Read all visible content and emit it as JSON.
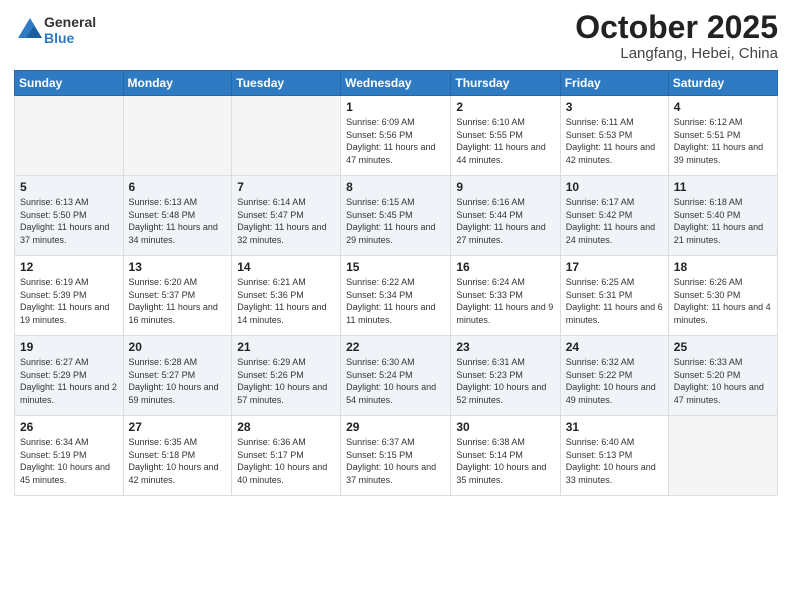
{
  "header": {
    "logo_line1": "General",
    "logo_line2": "Blue",
    "month": "October 2025",
    "location": "Langfang, Hebei, China"
  },
  "days_of_week": [
    "Sunday",
    "Monday",
    "Tuesday",
    "Wednesday",
    "Thursday",
    "Friday",
    "Saturday"
  ],
  "weeks": [
    [
      {
        "day": "",
        "info": ""
      },
      {
        "day": "",
        "info": ""
      },
      {
        "day": "",
        "info": ""
      },
      {
        "day": "1",
        "info": "Sunrise: 6:09 AM\nSunset: 5:56 PM\nDaylight: 11 hours and 47 minutes."
      },
      {
        "day": "2",
        "info": "Sunrise: 6:10 AM\nSunset: 5:55 PM\nDaylight: 11 hours and 44 minutes."
      },
      {
        "day": "3",
        "info": "Sunrise: 6:11 AM\nSunset: 5:53 PM\nDaylight: 11 hours and 42 minutes."
      },
      {
        "day": "4",
        "info": "Sunrise: 6:12 AM\nSunset: 5:51 PM\nDaylight: 11 hours and 39 minutes."
      }
    ],
    [
      {
        "day": "5",
        "info": "Sunrise: 6:13 AM\nSunset: 5:50 PM\nDaylight: 11 hours and 37 minutes."
      },
      {
        "day": "6",
        "info": "Sunrise: 6:13 AM\nSunset: 5:48 PM\nDaylight: 11 hours and 34 minutes."
      },
      {
        "day": "7",
        "info": "Sunrise: 6:14 AM\nSunset: 5:47 PM\nDaylight: 11 hours and 32 minutes."
      },
      {
        "day": "8",
        "info": "Sunrise: 6:15 AM\nSunset: 5:45 PM\nDaylight: 11 hours and 29 minutes."
      },
      {
        "day": "9",
        "info": "Sunrise: 6:16 AM\nSunset: 5:44 PM\nDaylight: 11 hours and 27 minutes."
      },
      {
        "day": "10",
        "info": "Sunrise: 6:17 AM\nSunset: 5:42 PM\nDaylight: 11 hours and 24 minutes."
      },
      {
        "day": "11",
        "info": "Sunrise: 6:18 AM\nSunset: 5:40 PM\nDaylight: 11 hours and 21 minutes."
      }
    ],
    [
      {
        "day": "12",
        "info": "Sunrise: 6:19 AM\nSunset: 5:39 PM\nDaylight: 11 hours and 19 minutes."
      },
      {
        "day": "13",
        "info": "Sunrise: 6:20 AM\nSunset: 5:37 PM\nDaylight: 11 hours and 16 minutes."
      },
      {
        "day": "14",
        "info": "Sunrise: 6:21 AM\nSunset: 5:36 PM\nDaylight: 11 hours and 14 minutes."
      },
      {
        "day": "15",
        "info": "Sunrise: 6:22 AM\nSunset: 5:34 PM\nDaylight: 11 hours and 11 minutes."
      },
      {
        "day": "16",
        "info": "Sunrise: 6:24 AM\nSunset: 5:33 PM\nDaylight: 11 hours and 9 minutes."
      },
      {
        "day": "17",
        "info": "Sunrise: 6:25 AM\nSunset: 5:31 PM\nDaylight: 11 hours and 6 minutes."
      },
      {
        "day": "18",
        "info": "Sunrise: 6:26 AM\nSunset: 5:30 PM\nDaylight: 11 hours and 4 minutes."
      }
    ],
    [
      {
        "day": "19",
        "info": "Sunrise: 6:27 AM\nSunset: 5:29 PM\nDaylight: 11 hours and 2 minutes."
      },
      {
        "day": "20",
        "info": "Sunrise: 6:28 AM\nSunset: 5:27 PM\nDaylight: 10 hours and 59 minutes."
      },
      {
        "day": "21",
        "info": "Sunrise: 6:29 AM\nSunset: 5:26 PM\nDaylight: 10 hours and 57 minutes."
      },
      {
        "day": "22",
        "info": "Sunrise: 6:30 AM\nSunset: 5:24 PM\nDaylight: 10 hours and 54 minutes."
      },
      {
        "day": "23",
        "info": "Sunrise: 6:31 AM\nSunset: 5:23 PM\nDaylight: 10 hours and 52 minutes."
      },
      {
        "day": "24",
        "info": "Sunrise: 6:32 AM\nSunset: 5:22 PM\nDaylight: 10 hours and 49 minutes."
      },
      {
        "day": "25",
        "info": "Sunrise: 6:33 AM\nSunset: 5:20 PM\nDaylight: 10 hours and 47 minutes."
      }
    ],
    [
      {
        "day": "26",
        "info": "Sunrise: 6:34 AM\nSunset: 5:19 PM\nDaylight: 10 hours and 45 minutes."
      },
      {
        "day": "27",
        "info": "Sunrise: 6:35 AM\nSunset: 5:18 PM\nDaylight: 10 hours and 42 minutes."
      },
      {
        "day": "28",
        "info": "Sunrise: 6:36 AM\nSunset: 5:17 PM\nDaylight: 10 hours and 40 minutes."
      },
      {
        "day": "29",
        "info": "Sunrise: 6:37 AM\nSunset: 5:15 PM\nDaylight: 10 hours and 37 minutes."
      },
      {
        "day": "30",
        "info": "Sunrise: 6:38 AM\nSunset: 5:14 PM\nDaylight: 10 hours and 35 minutes."
      },
      {
        "day": "31",
        "info": "Sunrise: 6:40 AM\nSunset: 5:13 PM\nDaylight: 10 hours and 33 minutes."
      },
      {
        "day": "",
        "info": ""
      }
    ]
  ]
}
